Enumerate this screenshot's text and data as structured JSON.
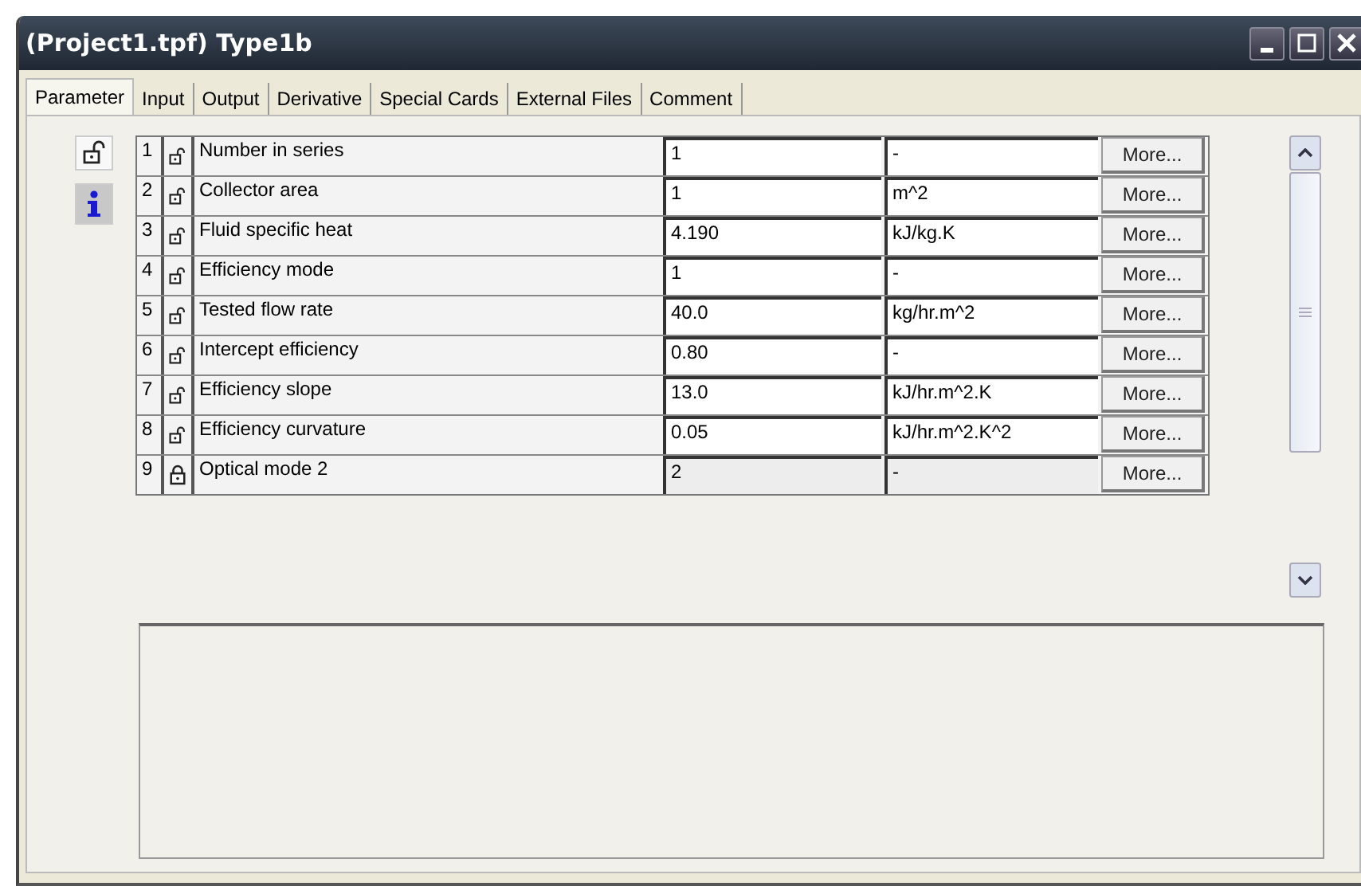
{
  "window": {
    "title": "(Project1.tpf) Type1b"
  },
  "tabs": [
    {
      "label": "Parameter",
      "selected": true
    },
    {
      "label": "Input",
      "selected": false
    },
    {
      "label": "Output",
      "selected": false
    },
    {
      "label": "Derivative",
      "selected": false
    },
    {
      "label": "Special Cards",
      "selected": false
    },
    {
      "label": "External Files",
      "selected": false
    },
    {
      "label": "Comment",
      "selected": false
    }
  ],
  "parameters": [
    {
      "index": "1",
      "locked": false,
      "name": "Number in series",
      "value": "1",
      "unit": "-",
      "button": "More..."
    },
    {
      "index": "2",
      "locked": false,
      "name": "Collector area",
      "value": "1",
      "unit": "m^2",
      "button": "More..."
    },
    {
      "index": "3",
      "locked": false,
      "name": "Fluid specific heat",
      "value": "4.190",
      "unit": "kJ/kg.K",
      "button": "More..."
    },
    {
      "index": "4",
      "locked": false,
      "name": "Efficiency mode",
      "value": "1",
      "unit": "-",
      "button": "More..."
    },
    {
      "index": "5",
      "locked": false,
      "name": "Tested flow rate",
      "value": "40.0",
      "unit": "kg/hr.m^2",
      "button": "More..."
    },
    {
      "index": "6",
      "locked": false,
      "name": "Intercept efficiency",
      "value": "0.80",
      "unit": "-",
      "button": "More..."
    },
    {
      "index": "7",
      "locked": false,
      "name": "Efficiency slope",
      "value": "13.0",
      "unit": "kJ/hr.m^2.K",
      "button": "More..."
    },
    {
      "index": "8",
      "locked": false,
      "name": "Efficiency curvature",
      "value": "0.05",
      "unit": "kJ/hr.m^2.K^2",
      "button": "More..."
    },
    {
      "index": "9",
      "locked": true,
      "name": "Optical mode 2",
      "value": "2",
      "unit": "-",
      "button": "More..."
    }
  ]
}
